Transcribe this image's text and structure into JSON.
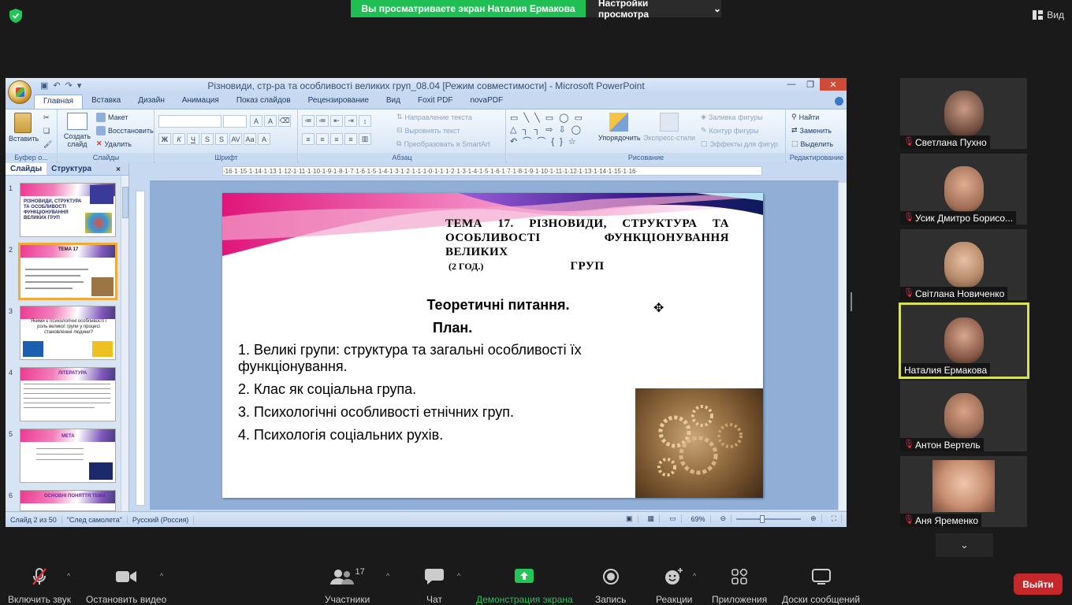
{
  "zoom": {
    "sharing_banner": "Вы просматриваете экран Наталия Ермакова",
    "view_settings": "Настройки просмотра",
    "view_button": "Вид",
    "exit": "Выйти",
    "toolbar": {
      "unmute": "Включить звук",
      "stop_video": "Остановить видео",
      "participants": "Участники",
      "participants_count": "17",
      "chat": "Чат",
      "share": "Демонстрация экрана",
      "record": "Запись",
      "reactions": "Реакции",
      "apps": "Приложения",
      "whiteboards": "Доски сообщений"
    },
    "participants": [
      {
        "name": "Светлана Пухно",
        "muted": true
      },
      {
        "name": "Усик Дмитро Борисо...",
        "muted": true
      },
      {
        "name": "Світлана Новиченко",
        "muted": true
      },
      {
        "name": "Наталия Ермакова",
        "muted": false
      },
      {
        "name": "Антон Вертель",
        "muted": true
      },
      {
        "name": "Аня Яременко",
        "muted": true
      }
    ],
    "accent_green": "#1fbf54",
    "exit_red": "#c4282b"
  },
  "ppt": {
    "title": "Різновиди, стр-ра та особливості великих груп_08.04 [Режим совместимости] - Microsoft PowerPoint",
    "tabs": [
      "Главная",
      "Вставка",
      "Дизайн",
      "Анимация",
      "Показ слайдов",
      "Рецензирование",
      "Вид",
      "Foxit PDF",
      "novaPDF"
    ],
    "ribbon": {
      "paste": "Вставить",
      "clipboard": "Буфер о...",
      "new_slide": "Создать слайд",
      "layout": "Макет",
      "reset": "Восстановить",
      "delete": "Удалить",
      "slides_group": "Слайды",
      "font_group": "Шрифт",
      "text_direction": "Направление текста",
      "align_text": "Выровнять текст",
      "convert_smartart": "Преобразовать в SmartArt",
      "paragraph_group": "Абзац",
      "arrange": "Упорядочить",
      "quick_styles": "Экспресс-стили",
      "shape_fill": "Заливка фигуры",
      "shape_outline": "Контур фигуры",
      "shape_effects": "Эффекты для фигур",
      "drawing_group": "Рисование",
      "find": "Найти",
      "replace": "Заменить",
      "select": "Выделить",
      "editing_group": "Редактирование"
    },
    "panel_tabs": [
      "Слайды",
      "Структура"
    ],
    "thumbs": [
      {
        "num": "1",
        "title": "РІЗНОВИДИ, СТРУКТУРА ТА ОСОБЛИВОСТІ ФУНКЦІОНУВАННЯ ВЕЛИКИХ ГРУП"
      },
      {
        "num": "2",
        "title": "ТЕМА 17"
      },
      {
        "num": "3",
        "title": "Якими є психологічні особливості і роль великої групи у процесі становлення людини?"
      },
      {
        "num": "4",
        "title": "ЛІТЕРАТУРА"
      },
      {
        "num": "5",
        "title": "МЕТА"
      },
      {
        "num": "6",
        "title": "ОСНОВНІ ПОНЯТТЯ ТЕМИ"
      }
    ],
    "ruler_text": "·16·1·15·1·14·1·13·1·12·1·11·1·10·1·9·1·8·1·7·1·6·1·5·1·4·1·3·1·2·1·1·1·0·1·1·1·2·1·3·1·4·1·5·1·6·1·7·1·8·1·9·1·10·1·11·1·12·1·13·1·14·1·15·1·16·",
    "slide": {
      "title_lines": [
        "ТЕМА 17. РІЗНОВИДИ, СТРУКТУРА ТА",
        "ОСОБЛИВОСТІ ФУНКЦІОНУВАННЯ ВЕЛИКИХ",
        "ГРУП"
      ],
      "subtitle": "(2 ГОД.)",
      "heading": "Теоретичні питання.",
      "plan": "План.",
      "items": [
        "1. Великі групи: структура та загальні особливості їх функціонування.",
        "2. Клас як соціальна група.",
        "3. Психологічні особливості етнічних груп.",
        "4. Психологія соціальних рухів."
      ]
    },
    "status": {
      "slide_of": "Слайд 2 из 50",
      "theme": "\"След самолета\"",
      "lang": "Русский (Россия)",
      "zoom": "69%"
    }
  }
}
